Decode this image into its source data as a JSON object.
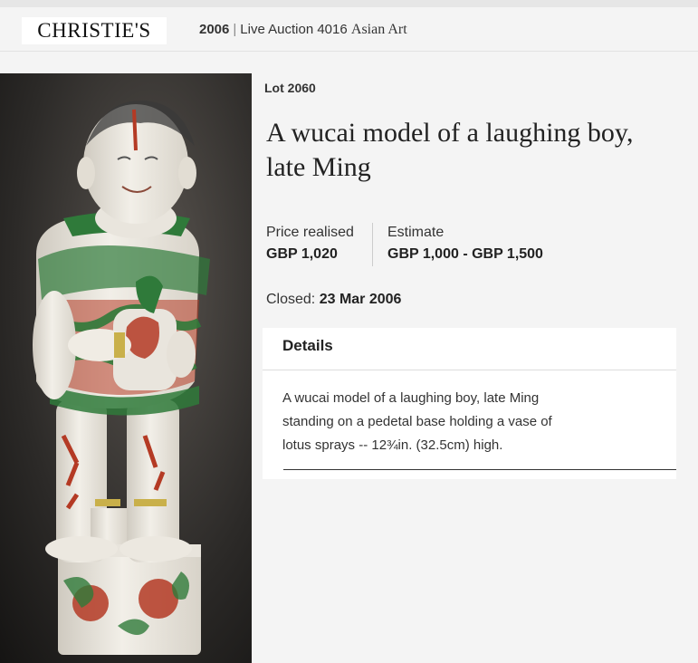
{
  "header": {
    "logo_text": "CHRISTIE'S",
    "year": "2006",
    "separator": "|",
    "auction": "Live Auction 4016",
    "department": "Asian Art"
  },
  "lot": {
    "number_label": "Lot 2060",
    "title_line1": "A wucai model of a laughing boy,",
    "title_line2": "late Ming"
  },
  "price": {
    "label": "Price realised",
    "value": "GBP 1,020"
  },
  "estimate": {
    "label": "Estimate",
    "value": "GBP 1,000 - GBP 1,500"
  },
  "closed": {
    "label": "Closed:",
    "date": "23 Mar 2006"
  },
  "details": {
    "heading": "Details",
    "line1": "A wucai model of a laughing boy, late Ming",
    "line2": "standing on a pedetal base holding a vase of",
    "line3": "lotus sprays -- 12¾in. (32.5cm) high."
  },
  "colors": {
    "background": "#f4f4f4",
    "porcelain": "#eeeae2",
    "iron_red": "#b43a24",
    "green_enamel": "#2f7a3a"
  }
}
